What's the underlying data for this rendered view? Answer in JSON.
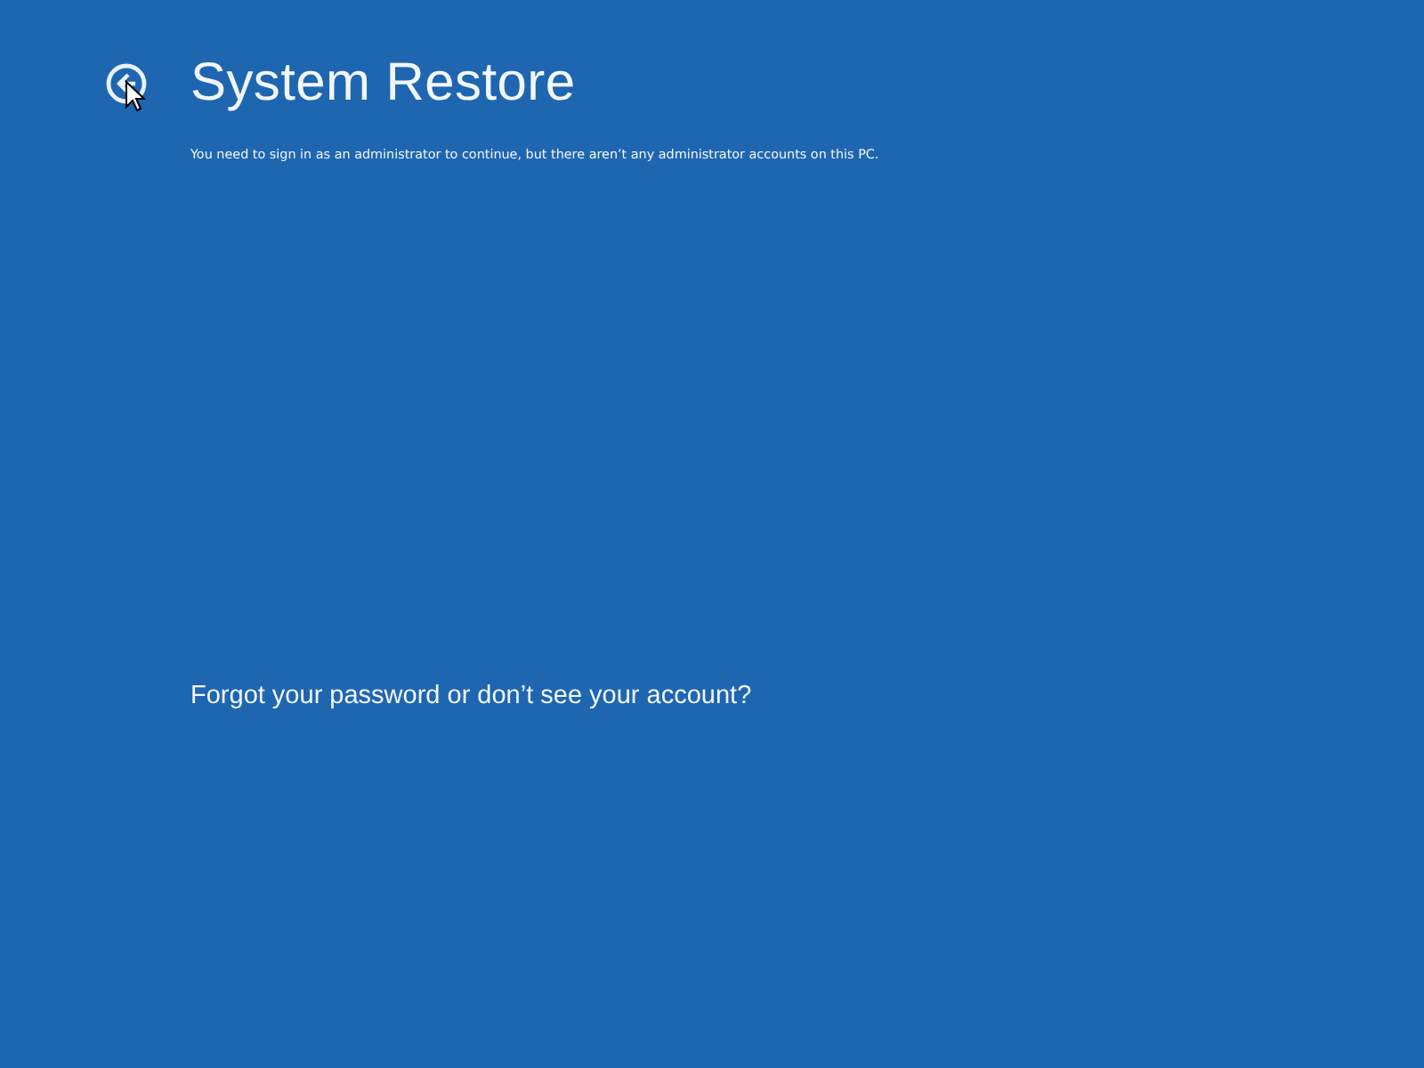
{
  "header": {
    "title": "System Restore"
  },
  "message": "You need to sign in as an administrator to continue, but there aren’t any administrator accounts on this PC.",
  "link": "Forgot your password or don’t see your account?"
}
